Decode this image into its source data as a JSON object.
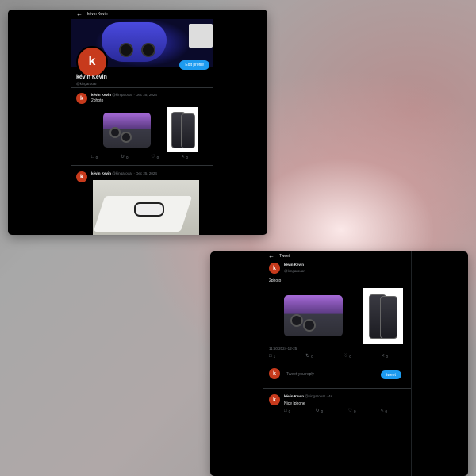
{
  "profile_window": {
    "topbar": {
      "back_icon": "arrow-left-icon",
      "title": "kévin Kevin"
    },
    "avatar_letter": "k",
    "edit_profile_label": "Edit profile",
    "profile_name": "kévin Kevin",
    "profile_handle": "@kingarouar",
    "tweets": [
      {
        "author": "kévin Kevin",
        "handle": "@kingarouar",
        "date": "Dec 25, 2024",
        "text": "2photo",
        "actions": {
          "reply": "0",
          "retweet": "0",
          "like": "0",
          "share": "0"
        }
      },
      {
        "author": "kévin Kevin",
        "handle": "@kingarouar",
        "date": "Dec 25, 2024",
        "text": ""
      }
    ]
  },
  "tweet_window": {
    "topbar": {
      "back_icon": "arrow-left-icon",
      "title": "Tweet"
    },
    "author": "kévin Kevin",
    "handle": "@kingarouar",
    "text": "2photo",
    "timestamp": "11:50 2024-12-25",
    "actions": {
      "reply": "1",
      "retweet": "0",
      "like": "0",
      "share": "0"
    },
    "reply_placeholder": "Tweet you reply",
    "tweet_button": "tweet",
    "reply": {
      "author": "kévin Kevin",
      "handle": "@kingarouar",
      "age": "4s",
      "text": "Nice Iphone",
      "actions": {
        "reply": "0",
        "retweet": "0",
        "like": "0",
        "share": "0"
      }
    }
  },
  "colors": {
    "accent": "#1d9bf0",
    "avatar": "#c73a1c",
    "background": "#000000",
    "muted": "#71767b"
  }
}
